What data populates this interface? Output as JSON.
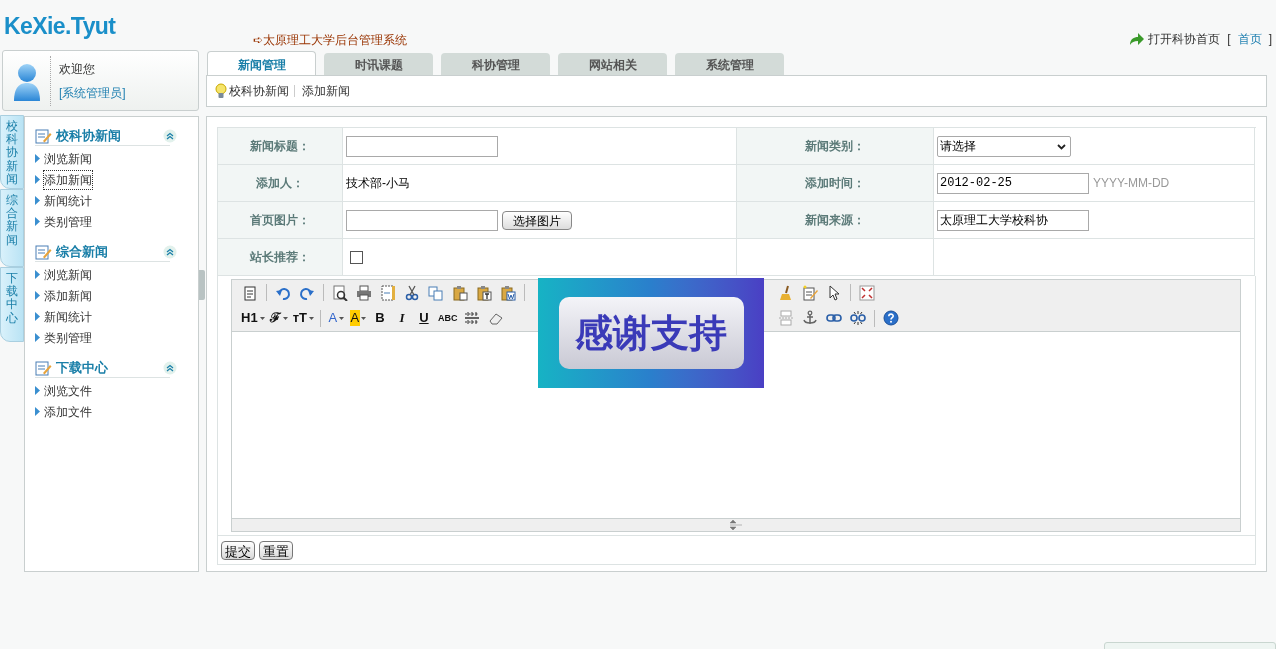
{
  "header": {
    "logo": "KeXie.Tyut",
    "system_title": "➪太原理工大学后台管理系统",
    "home_text": "打开科协首页",
    "bracket_open": "[",
    "home_link": "首页",
    "bracket_close": "]"
  },
  "user": {
    "greeting": "欢迎您",
    "role": "[系统管理员]"
  },
  "tabs": [
    {
      "label": "新闻管理",
      "selected": true
    },
    {
      "label": "时讯课题",
      "selected": false
    },
    {
      "label": "科协管理",
      "selected": false
    },
    {
      "label": "网站相关",
      "selected": false
    },
    {
      "label": "系统管理",
      "selected": false
    }
  ],
  "breadcrumb": [
    "校科协新闻",
    "添加新闻"
  ],
  "side_tabs": [
    "校科协新闻",
    "综合新闻",
    "下载中心"
  ],
  "sidebar": [
    {
      "title": "校科协新闻",
      "items": [
        {
          "label": "浏览新闻",
          "focused": false
        },
        {
          "label": "添加新闻",
          "focused": true
        },
        {
          "label": "新闻统计",
          "focused": false
        },
        {
          "label": "类别管理",
          "focused": false
        }
      ]
    },
    {
      "title": "综合新闻",
      "items": [
        {
          "label": "浏览新闻",
          "focused": false
        },
        {
          "label": "添加新闻",
          "focused": false
        },
        {
          "label": "新闻统计",
          "focused": false
        },
        {
          "label": "类别管理",
          "focused": false
        }
      ]
    },
    {
      "title": "下载中心",
      "items": [
        {
          "label": "浏览文件",
          "focused": false
        },
        {
          "label": "添加文件",
          "focused": false
        }
      ]
    }
  ],
  "form": [
    [
      {
        "label": "新闻标题：",
        "kind": "input"
      },
      {
        "label": "新闻类别：",
        "kind": "select",
        "value": "请选择"
      }
    ],
    [
      {
        "label": "添加人：",
        "kind": "text",
        "value": "技术部-小马"
      },
      {
        "label": "添加时间：",
        "kind": "input",
        "value": "2012-02-25",
        "hint": "YYYY-MM-DD"
      }
    ],
    [
      {
        "label": "首页图片：",
        "kind": "file",
        "button": "选择图片"
      },
      {
        "label": "新闻来源：",
        "kind": "input",
        "value": "太原理工大学校科协"
      }
    ],
    [
      {
        "label": "站长推荐：",
        "kind": "checkbox",
        "checked": false
      },
      {
        "kind": "blank"
      }
    ]
  ],
  "toolbar": [
    {
      "left": [
        {
          "kind": "source"
        },
        {
          "kind": "sep"
        },
        {
          "kind": "undo"
        },
        {
          "kind": "redo"
        },
        {
          "kind": "sep"
        },
        {
          "kind": "preview"
        },
        {
          "kind": "print"
        },
        {
          "kind": "template"
        },
        {
          "kind": "cut"
        },
        {
          "kind": "copy"
        },
        {
          "kind": "paste"
        },
        {
          "kind": "pastetext"
        },
        {
          "kind": "pasteword"
        },
        {
          "kind": "sep"
        }
      ],
      "right": [
        {
          "kind": "broom"
        },
        {
          "kind": "editdoc"
        },
        {
          "kind": "cursor"
        },
        {
          "kind": "sep"
        },
        {
          "kind": "fullscreen"
        }
      ]
    },
    {
      "left": [
        {
          "kind": "dropdown",
          "label": "H1"
        },
        {
          "kind": "dropdown",
          "label": "ℱ"
        },
        {
          "kind": "dropdown",
          "label": "ᴛT"
        },
        {
          "kind": "sep"
        },
        {
          "kind": "fontcolor",
          "label": "A"
        },
        {
          "kind": "bgcolor",
          "label": "A"
        },
        {
          "kind": "text",
          "label": "B"
        },
        {
          "kind": "text",
          "label": "I"
        },
        {
          "kind": "text",
          "label": "U"
        },
        {
          "kind": "text",
          "label": "ABC"
        },
        {
          "kind": "hr"
        },
        {
          "kind": "eraser"
        }
      ],
      "right": [
        {
          "kind": "pagebreak"
        },
        {
          "kind": "anchor"
        },
        {
          "kind": "link"
        },
        {
          "kind": "unlink"
        },
        {
          "kind": "sep"
        },
        {
          "kind": "help"
        }
      ]
    }
  ],
  "overlay": "感谢支持",
  "buttons": [
    "提交",
    "重置"
  ]
}
